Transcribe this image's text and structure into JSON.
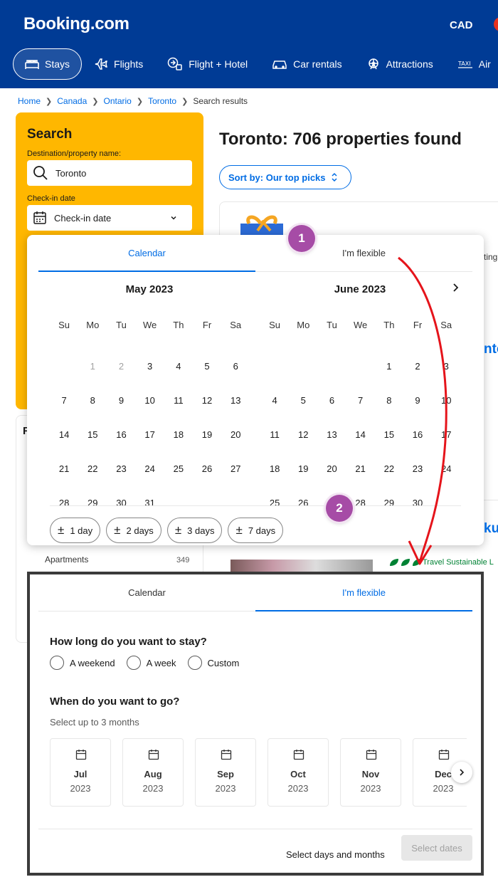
{
  "header": {
    "logo": "Booking.com",
    "currency": "CAD",
    "nav": [
      {
        "label": "Stays",
        "active": true
      },
      {
        "label": "Flights"
      },
      {
        "label": "Flight + Hotel"
      },
      {
        "label": "Car rentals"
      },
      {
        "label": "Attractions"
      },
      {
        "label": "Air"
      }
    ]
  },
  "breadcrumb": [
    "Home",
    "Canada",
    "Ontario",
    "Toronto",
    "Search results"
  ],
  "search": {
    "title": "Search",
    "destination_label": "Destination/property name:",
    "destination_value": "Toronto",
    "checkin_label": "Check-in date",
    "checkin_placeholder": "Check-in date"
  },
  "filters": {
    "heading_initial": "F",
    "apartments_label": "Apartments",
    "apartments_count": "349"
  },
  "results": {
    "title": "Toronto: 706 properties found",
    "sort_label": "Sort by: Our top picks",
    "sustainable_label": "Travel Sustainable L"
  },
  "calendar_popup": {
    "tabs": [
      "Calendar",
      "I'm flexible"
    ],
    "active_tab": "Calendar",
    "weekdays": [
      "Su",
      "Mo",
      "Tu",
      "We",
      "Th",
      "Fr",
      "Sa"
    ],
    "months": [
      {
        "title": "May 2023",
        "first_weekday": 1,
        "days": 31,
        "past_until": 2
      },
      {
        "title": "June 2023",
        "first_weekday": 4,
        "days": 30,
        "past_until": 0
      }
    ],
    "flex_chips": [
      "1 day",
      "2 days",
      "3 days",
      "7 days"
    ]
  },
  "badges": [
    "1",
    "2"
  ],
  "flexible_popup": {
    "tabs": [
      "Calendar",
      "I'm flexible"
    ],
    "active_tab": "I'm flexible",
    "stay_question": "How long do you want to stay?",
    "stay_options": [
      "A weekend",
      "A week",
      "Custom"
    ],
    "when_question": "When do you want to go?",
    "when_hint": "Select up to 3 months",
    "months": [
      {
        "month": "Jul",
        "year": "2023"
      },
      {
        "month": "Aug",
        "year": "2023"
      },
      {
        "month": "Sep",
        "year": "2023"
      },
      {
        "month": "Oct",
        "year": "2023"
      },
      {
        "month": "Nov",
        "year": "2023"
      },
      {
        "month": "Dec",
        "year": "2023"
      }
    ],
    "footer_text": "Select days and months",
    "select_button": "Select dates"
  },
  "colors": {
    "brand_blue": "#003b95",
    "accent_blue": "#006ce4",
    "search_yellow": "#ffb700",
    "annotation_red": "#e5141b",
    "badge_purple": "#a64ca6"
  }
}
